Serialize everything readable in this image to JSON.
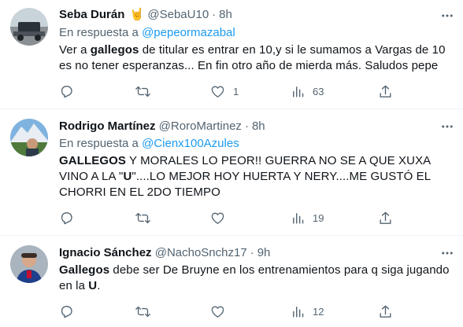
{
  "tweets": [
    {
      "name": "Seba Durán",
      "emoji": "🤘",
      "handle": "@SebaU10",
      "time": "8h",
      "reply_prefix": "En respuesta a",
      "reply_to": "@pepeormazabal",
      "body": {
        "p1": "Ver a ",
        "b1": "gallegos",
        "p2": " de titular es entrar en 10,y si le sumamos a Vargas de 10 es no tener esperanzas... En fin otro año de mierda más. Saludos pepe"
      },
      "stats": {
        "replies": "",
        "retweets": "",
        "likes": "1",
        "views": "63"
      }
    },
    {
      "name": "Rodrigo Martínez",
      "handle": "@RoroMartinez",
      "time": "8h",
      "reply_prefix": "En respuesta a",
      "reply_to": "@Cienx100Azules",
      "body": {
        "b1": "GALLEGOS",
        "p1": " Y MORALES LO PEOR!! GUERRA NO SE A QUE XUXA VINO A LA \"",
        "b2": "U",
        "p2": "\"....LO MEJOR HOY HUERTA Y NERY....ME GUSTÓ EL CHORRI EN EL 2DO TIEMPO"
      },
      "stats": {
        "replies": "",
        "retweets": "",
        "likes": "",
        "views": "19"
      }
    },
    {
      "name": "Ignacio Sánchez",
      "handle": "@NachoSnchz17",
      "time": "9h",
      "body": {
        "b1": "Gallegos",
        "p1": " debe ser De Bruyne en los entrenamientos para q siga jugando en la ",
        "b2": "U",
        "p2": "."
      },
      "stats": {
        "replies": "",
        "retweets": "",
        "likes": "",
        "views": "12"
      }
    }
  ],
  "colors": {
    "text": "#0f1419",
    "muted": "#536471",
    "link": "#1d9bf0",
    "divider": "#eff3f4"
  },
  "icons": [
    "reply-icon",
    "retweet-icon",
    "like-icon",
    "views-icon",
    "share-icon",
    "more-icon"
  ]
}
